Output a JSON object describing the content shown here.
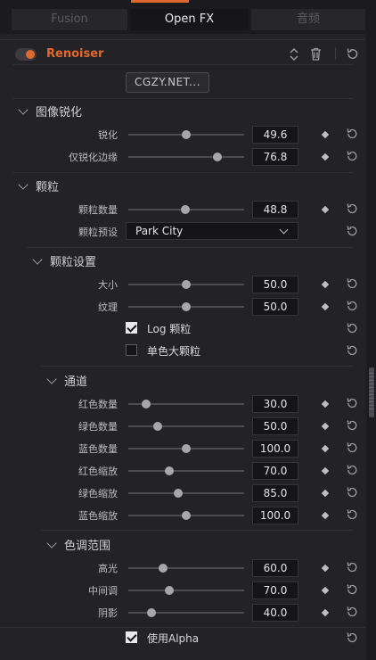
{
  "tabs": [
    {
      "label": "Fusion",
      "active": false
    },
    {
      "label": "Open FX",
      "active": true
    },
    {
      "label": "音频",
      "active": false
    }
  ],
  "plugin": {
    "title": "Renoiser",
    "button_label": "CGZY.NET..."
  },
  "colors": {
    "accent": "#e0692f",
    "background": "#232326",
    "field": "#151517"
  },
  "sections": {
    "sharpen": {
      "title": "图像锐化"
    },
    "grain": {
      "title": "颗粒"
    },
    "grain_settings": {
      "title": "颗粒设置"
    },
    "channels": {
      "title": "通道"
    },
    "tone_range": {
      "title": "色调范围"
    }
  },
  "params": {
    "sharpen": {
      "label": "锐化",
      "value": "49.6",
      "fraction": 0.5
    },
    "edge_sharpen": {
      "label": "仅锐化边缘",
      "value": "76.8",
      "fraction": 0.77
    },
    "grain_amount": {
      "label": "颗粒数量",
      "value": "48.8",
      "fraction": 0.49
    },
    "size": {
      "label": "大小",
      "value": "50.0",
      "fraction": 0.5
    },
    "texture": {
      "label": "纹理",
      "value": "50.0",
      "fraction": 0.5
    },
    "red_amount": {
      "label": "红色数量",
      "value": "30.0",
      "fraction": 0.15
    },
    "green_amount": {
      "label": "绿色数量",
      "value": "50.0",
      "fraction": 0.25
    },
    "blue_amount": {
      "label": "蓝色数量",
      "value": "100.0",
      "fraction": 0.5
    },
    "red_scale": {
      "label": "红色缩放",
      "value": "70.0",
      "fraction": 0.35
    },
    "green_scale": {
      "label": "绿色缩放",
      "value": "85.0",
      "fraction": 0.43
    },
    "blue_scale": {
      "label": "蓝色缩放",
      "value": "100.0",
      "fraction": 0.5
    },
    "highlights": {
      "label": "高光",
      "value": "60.0",
      "fraction": 0.3
    },
    "midtones": {
      "label": "中间调",
      "value": "70.0",
      "fraction": 0.35
    },
    "shadows": {
      "label": "阴影",
      "value": "40.0",
      "fraction": 0.2
    }
  },
  "grain_preset": {
    "label": "颗粒预设",
    "value": "Park City"
  },
  "checkboxes": {
    "log_grain": {
      "label": "Log 颗粒",
      "checked": true
    },
    "mono_grain": {
      "label": "单色大颗粒",
      "checked": false
    },
    "use_alpha": {
      "label": "使用Alpha",
      "checked": true
    }
  },
  "icons": [
    "toggle-icon",
    "up-down-arrows-icon",
    "trash-icon",
    "reset-icon",
    "keyframe-diamond-icon",
    "chevron-down-icon",
    "checkmark-icon"
  ]
}
